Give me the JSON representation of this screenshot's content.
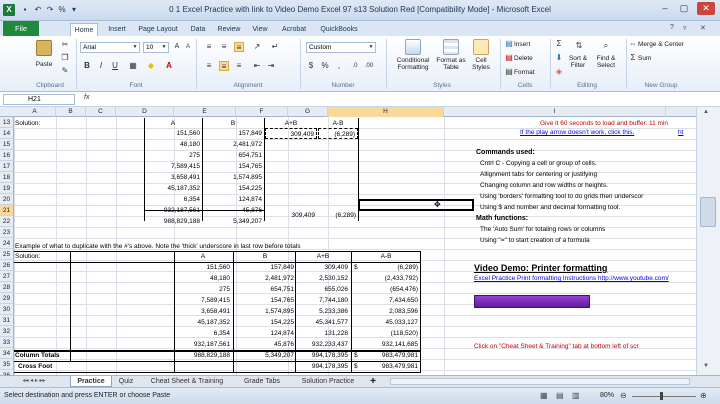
{
  "window": {
    "title": "0 1 Excel Practice with link to Video Demo Excel 97 s13 Solution Red  [Compatibility Mode]  -  Microsoft Excel",
    "qat_icons": [
      "save-icon",
      "undo-icon",
      "redo-icon",
      "percent-icon"
    ]
  },
  "ribbon": {
    "file": "File",
    "tabs": [
      "Home",
      "Insert",
      "Page Layout",
      "Data",
      "Review",
      "View",
      "Acrobat",
      "QuickBooks"
    ],
    "font_name": "Arial",
    "font_size": "10",
    "number_format": "Custom",
    "groups": {
      "clipboard": "Clipboard",
      "font": "Font",
      "alignment": "Alignment",
      "number": "Number",
      "styles": "Styles",
      "cells": "Cells",
      "editing": "Editing",
      "new_group": "New Group"
    },
    "paste": "Paste",
    "conditional_formatting": "Conditional Formatting",
    "format_as_table": "Format as Table",
    "cell_styles": "Cell Styles",
    "insert": "Insert",
    "delete": "Delete",
    "format": "Format",
    "sort_filter": "Sort & Filter",
    "find_select": "Find & Select",
    "merge_center": "Merge & Center",
    "sum": "Sum"
  },
  "formula_bar": {
    "name_box": "H21",
    "fx": "fx"
  },
  "grid": {
    "columns": [
      "A",
      "B",
      "C",
      "D",
      "E",
      "F",
      "G",
      "H",
      "I"
    ],
    "selected_column": "H",
    "rows": [
      "13",
      "14",
      "15",
      "16",
      "17",
      "18",
      "19",
      "20",
      "21",
      "22",
      "23",
      "24",
      "25",
      "26",
      "27",
      "28",
      "29",
      "30",
      "31",
      "32",
      "33",
      "34",
      "35",
      "36",
      "37"
    ],
    "selected_row": "21",
    "upper": {
      "a13": "Solution:",
      "d13": "A",
      "e13": "B",
      "f13": "A+B",
      "g13": "A-B",
      "d": [
        "151,560",
        "48,180",
        "275",
        "7,589,415",
        "3,658,491",
        "45,187,352",
        "6,354",
        "932,187,561",
        "988,829,188"
      ],
      "e": [
        "157,849",
        "2,481,972",
        "654,751",
        "154,765",
        "1,574,895",
        "154,225",
        "124,874",
        "45,876",
        "5,349,207"
      ],
      "f14": "309,409",
      "g14": "(6,289)",
      "f22": "309,409",
      "g22": "(6,289)"
    },
    "example_note": "Example of what to duplicate with the #'s above. Note the 'thick' underscore in last row before totals",
    "lower": {
      "a26": "Solution:",
      "d26": "A",
      "e26": "B",
      "f26": "A+B",
      "g26": "A-B",
      "d": [
        "151,560",
        "48,180",
        "275",
        "7,589,415",
        "3,658,491",
        "45,187,352",
        "6,354",
        "932,187,561"
      ],
      "e": [
        "157,849",
        "2,481,972",
        "654,751",
        "154,765",
        "1,574,895",
        "154,225",
        "124,874",
        "45,876"
      ],
      "f": [
        "309,409",
        "2,530,152",
        "655,026",
        "7,744,180",
        "5,233,386",
        "45,341,577",
        "131,228",
        "932,233,437"
      ],
      "g": [
        "(6,289)",
        "(2,433,792)",
        "(654,476)",
        "7,434,650",
        "2,083,596",
        "45,033,127",
        "(118,520)",
        "932,141,685"
      ],
      "dollar": "$",
      "a35": "Column Totals",
      "d35": "988,829,188",
      "e35": "5,349,207",
      "f35": "994,178,395",
      "g35": "983,479,981",
      "a36": "Cross Foot",
      "f36": "994,178,395",
      "g36": "983,479,981"
    },
    "right_panel": {
      "i13": "Give it 60 seconds to load and buffer.  11 min",
      "i14": "If the play arrow doesn't work, click this.",
      "i14b": "ht",
      "commands_title": "Commands used:",
      "commands": [
        "Cntrl C - Copying a cell or group of cells.",
        "Allignment tabs for centering or justifying",
        "Changing column and row widths or heights.",
        "Using 'borders' formatting tool to do grids then underscor",
        "Using $ and number and decimal formatting tool."
      ],
      "math_title": "Math functions:",
      "math": [
        "The 'Auto Sum' for totaling rows or columns",
        "Using \"=\" to start creation of a formula"
      ],
      "video_demo": "Video Demo:  Printer formatting",
      "video_link": "Excel Practice Print formatting Instructions http://www.youtube.com/",
      "hint": "Click on \"Cheat Sheet & Training\" tab at bottom left of scr"
    }
  },
  "sheet_tabs": [
    "Practice",
    "Quiz",
    "Cheat Sheet & Training",
    "Grade Tabs",
    "Solution Practice"
  ],
  "status": {
    "text": "Select destination and press ENTER or choose Paste",
    "zoom": "80%"
  },
  "colors": {
    "excel_green": "#1f8a3e",
    "red_text": "#c00000",
    "link_blue": "#0000ee",
    "selection": "#f9d99a"
  }
}
